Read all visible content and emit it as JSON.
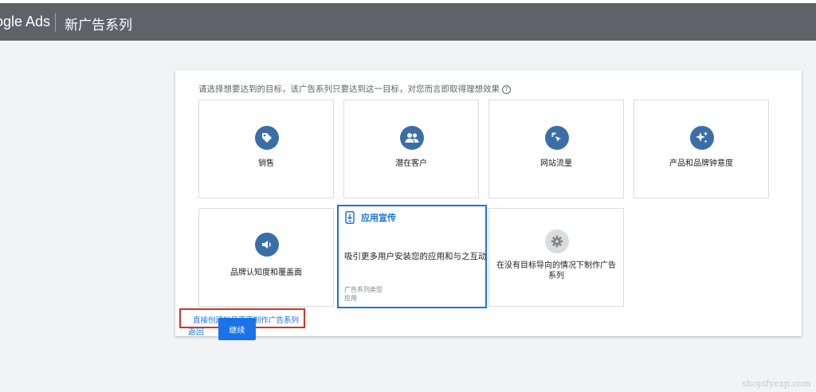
{
  "header": {
    "brand": "ogle Ads",
    "title": "新广告系列"
  },
  "panel": {
    "prompt": "请选择想要达到的目标，该广告系列只要达到这一目标，对您而言即取得理想效果",
    "help_icon": "question-circle-icon",
    "cards": [
      {
        "label": "销售",
        "icon": "tag-icon"
      },
      {
        "label": "潜在客户",
        "icon": "people-icon"
      },
      {
        "label": "网站流量",
        "icon": "cursor-click-icon"
      },
      {
        "label": "产品和品牌钟意度",
        "icon": "sparkle-icon"
      },
      {
        "label": "品牌认知度和覆盖面",
        "icon": "speaker-icon"
      },
      {
        "label": "在没有目标导向的情况下制作广告系列",
        "icon": "gear-icon"
      }
    ],
    "selected": {
      "title": "应用宣传",
      "icon": "phone-download-icon",
      "description": "吸引更多用户安装您的应用和与之互动",
      "meta_label": "广告系列类型",
      "meta_value": "应用"
    },
    "link": "直接创建帐号而不制作广告系列"
  },
  "footer": {
    "back": "返回",
    "continue": "继续"
  },
  "watermark": "shopifyexp.com",
  "colors": {
    "header": "#5f6368",
    "accent": "#1a73e8",
    "icon_circle": "#3c6ea6",
    "highlight_box": "#d93025"
  }
}
